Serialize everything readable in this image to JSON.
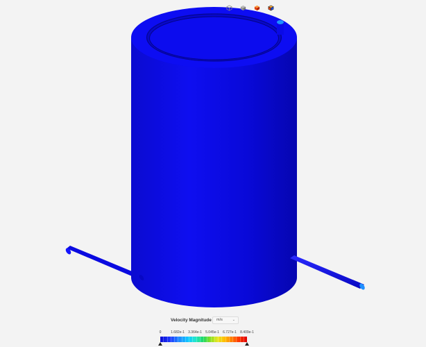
{
  "toolbar": {
    "views": [
      {
        "icon": "wireframe-cube-icon"
      },
      {
        "icon": "solid-cube-icon"
      },
      {
        "icon": "colored-cube-icon"
      },
      {
        "icon": "colored-cube-edges-icon"
      }
    ]
  },
  "legend": {
    "title": "Velocity Magnitude",
    "info_label": "i",
    "unit": "m/s",
    "ticks": [
      "0",
      "1.682e-1",
      "3.364e-1",
      "5.045e-1",
      "6.727e-1",
      "8.409e-1"
    ],
    "min_value": 0,
    "max_value": 0.8409
  },
  "colors": {
    "background": "#f3f3f3",
    "geometry": "#0a0ae8",
    "geometry_dark": "#0606b6",
    "outlet_tip": "#1e90ff"
  }
}
